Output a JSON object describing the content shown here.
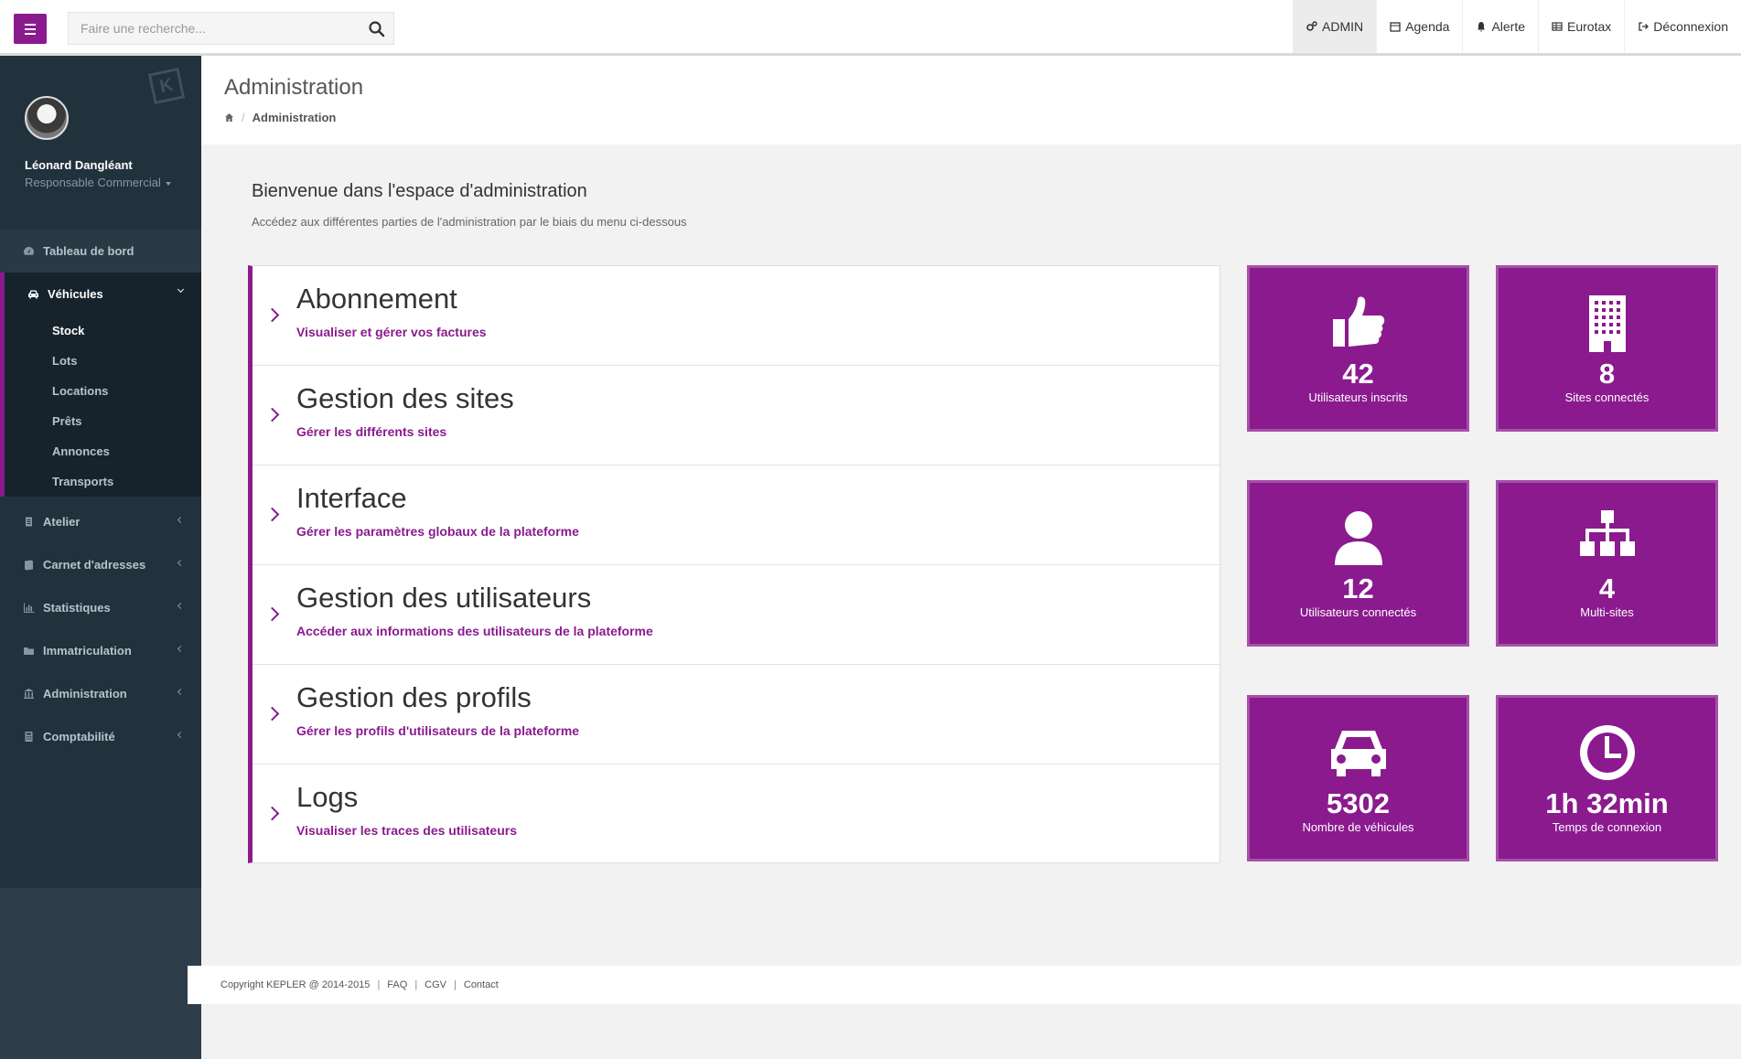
{
  "topbar": {
    "search_placeholder": "Faire une recherche...",
    "nav": [
      {
        "label": "ADMIN",
        "icon": "gears-icon"
      },
      {
        "label": "Agenda",
        "icon": "calendar-icon"
      },
      {
        "label": "Alerte",
        "icon": "bell-icon"
      },
      {
        "label": "Eurotax",
        "icon": "table-icon"
      },
      {
        "label": "Déconnexion",
        "icon": "sign-out-icon"
      }
    ]
  },
  "sidebar": {
    "user": {
      "name": "Léonard Dangléant",
      "role": "Responsable Commercial"
    },
    "items": [
      {
        "label": "Tableau de bord",
        "icon": "dashboard-icon"
      },
      {
        "label": "Véhicules",
        "icon": "car-icon"
      },
      {
        "label": "Atelier",
        "icon": "clipboard-icon"
      },
      {
        "label": "Carnet d'adresses",
        "icon": "book-icon"
      },
      {
        "label": "Statistiques",
        "icon": "bar-chart-icon"
      },
      {
        "label": "Immatriculation",
        "icon": "folder-icon"
      },
      {
        "label": "Administration",
        "icon": "bank-icon"
      },
      {
        "label": "Comptabilité",
        "icon": "calculator-icon"
      }
    ],
    "vehicules_sub": [
      "Stock",
      "Lots",
      "Locations",
      "Prêts",
      "Annonces",
      "Transports"
    ]
  },
  "header": {
    "title": "Administration",
    "breadcrumb": "Administration"
  },
  "welcome": {
    "title": "Bienvenue dans l'espace d'administration",
    "subtitle": "Accédez aux différentes parties de l'administration par le biais du menu ci-dessous"
  },
  "admin_items": [
    {
      "title": "Abonnement",
      "subtitle": "Visualiser et gérer vos factures"
    },
    {
      "title": "Gestion des sites",
      "subtitle": "Gérer les différents sites"
    },
    {
      "title": "Interface",
      "subtitle": "Gérer les paramètres globaux de la plateforme"
    },
    {
      "title": "Gestion des utilisateurs",
      "subtitle": "Accéder aux informations des utilisateurs de la plateforme"
    },
    {
      "title": "Gestion des profils",
      "subtitle": "Gérer les profils d'utilisateurs de la plateforme"
    },
    {
      "title": "Logs",
      "subtitle": "Visualiser les traces des utilisateurs"
    }
  ],
  "tiles": [
    {
      "value": "42",
      "label": "Utilisateurs inscrits",
      "icon": "thumbs-up-icon"
    },
    {
      "value": "8",
      "label": "Sites connectés",
      "icon": "building-icon"
    },
    {
      "value": "12",
      "label": "Utilisateurs connectés",
      "icon": "user-icon"
    },
    {
      "value": "4",
      "label": "Multi-sites",
      "icon": "sitemap-icon"
    },
    {
      "value": "5302",
      "label": "Nombre de véhicules",
      "icon": "car-icon"
    },
    {
      "value": "1h 32min",
      "label": "Temps de connexion",
      "icon": "clock-icon"
    }
  ],
  "footer": {
    "copyright": "Copyright KEPLER @ 2014-2015",
    "links": [
      "FAQ",
      "CGV",
      "Contact"
    ]
  },
  "colors": {
    "accent": "#8a1a8e",
    "sidebar": "#22323c"
  }
}
